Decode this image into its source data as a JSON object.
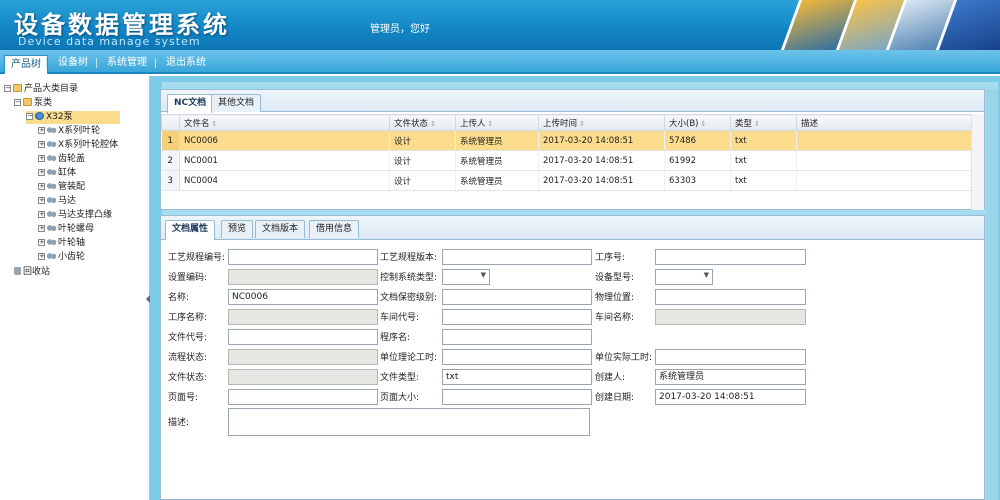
{
  "header": {
    "title": "设备数据管理系统",
    "subtitle": "Device data manage system",
    "greeting": "管理员，您好"
  },
  "nav": {
    "items": [
      "产品树",
      "设备树",
      "系统管理",
      "退出系统"
    ],
    "active": "产品树"
  },
  "tree": {
    "root": "产品大类目录",
    "category": "泵类",
    "selected": "X32泵",
    "children": [
      "X系列叶轮",
      "X系列叶轮腔体",
      "齿轮盖",
      "缸体",
      "管装配",
      "马达",
      "马达支撑凸缘",
      "叶轮螺母",
      "叶轮轴",
      "小齿轮"
    ],
    "recycle": "回收站"
  },
  "docs": {
    "tabs": [
      "NC文档",
      "其他文档"
    ],
    "columns": [
      "文件名",
      "文件状态",
      "上传人",
      "上传时间",
      "大小(B)",
      "类型",
      "描述"
    ],
    "rows": [
      {
        "no": "1",
        "name": "NC0006",
        "status": "设计",
        "uploader": "系统管理员",
        "time": "2017-03-20 14:08:51",
        "size": "57486",
        "type": "txt",
        "desc": ""
      },
      {
        "no": "2",
        "name": "NC0001",
        "status": "设计",
        "uploader": "系统管理员",
        "time": "2017-03-20 14:08:51",
        "size": "61992",
        "type": "txt",
        "desc": ""
      },
      {
        "no": "3",
        "name": "NC0004",
        "status": "设计",
        "uploader": "系统管理员",
        "time": "2017-03-20 14:08:51",
        "size": "63303",
        "type": "txt",
        "desc": ""
      }
    ]
  },
  "props": {
    "tabs": [
      "文档属性",
      "预览",
      "文档版本",
      "借用信息"
    ],
    "labels": {
      "process_no": "工艺规程编号:",
      "process_ver": "工艺规程版本:",
      "step_no": "工序号:",
      "equip_code": "设置编码:",
      "ctrl_type": "控制系统类型:",
      "equip_model": "设备型号:",
      "name": "名称:",
      "secret": "文档保密级别:",
      "location": "物理位置:",
      "step_name": "工序名称:",
      "workshop_code": "车间代号:",
      "workshop_name": "车间名称:",
      "file_code": "文件代号:",
      "program": "程序名:",
      "flow_status": "流程状态:",
      "theory_hours": "单位理论工时:",
      "actual_hours": "单位实际工时:",
      "file_status": "文件状态:",
      "file_type": "文件类型:",
      "creator": "创建人:",
      "page_no": "页面号:",
      "page_size": "页面大小:",
      "create_date": "创建日期:",
      "desc": "描述:"
    },
    "values": {
      "name": "NC0006",
      "file_type": "txt",
      "creator": "系统管理员",
      "create_date": "2017-03-20 14:08:51"
    }
  }
}
